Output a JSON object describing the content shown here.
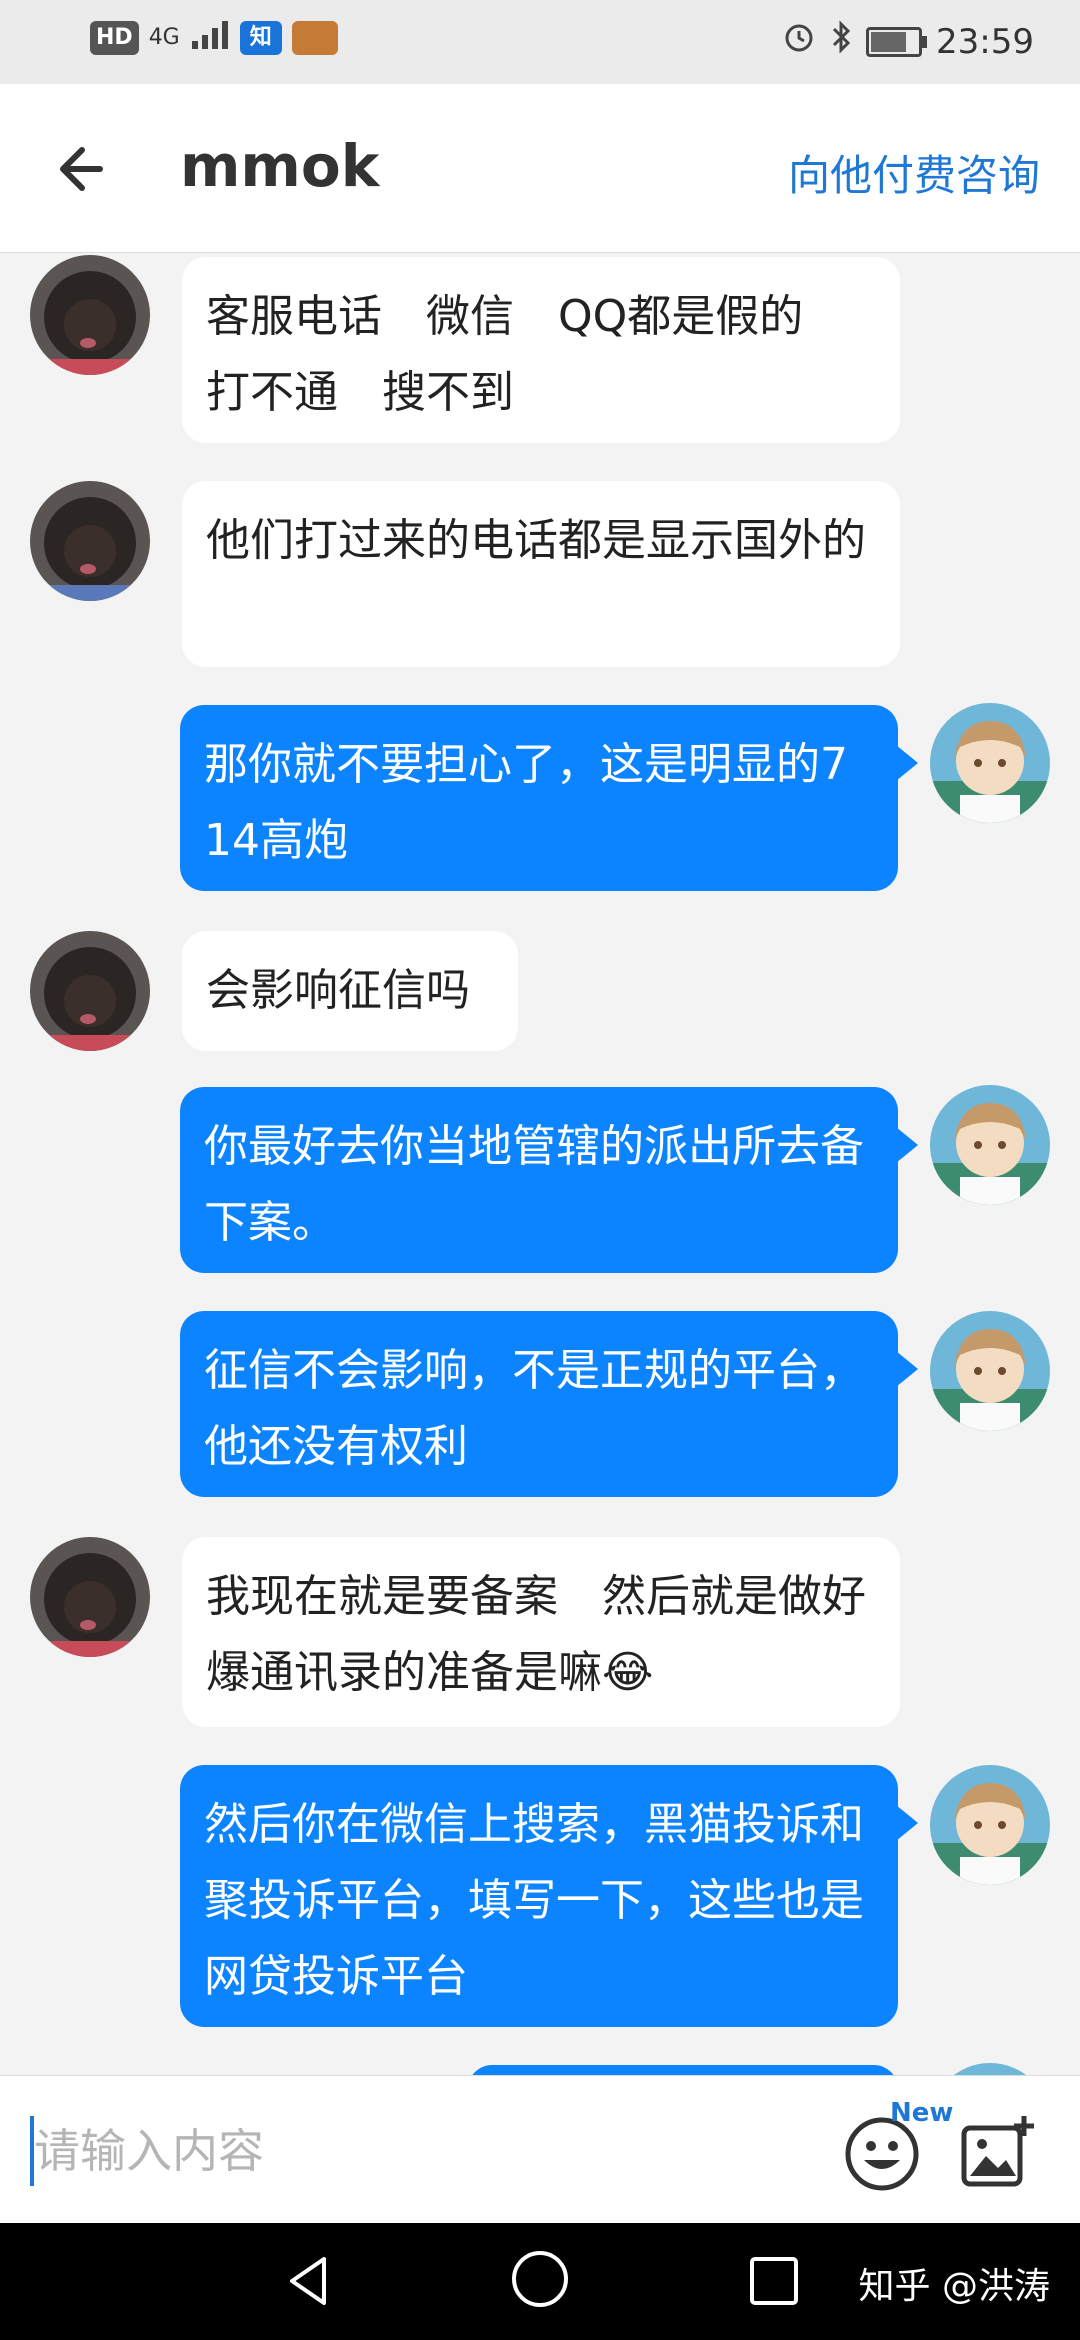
{
  "status_bar": {
    "hd": "HD",
    "network": "4G",
    "zhihu_badge": "知",
    "time": "23:59"
  },
  "header": {
    "back_icon": "arrow-left",
    "title": "mmok",
    "consult_label": "向他付费咨询"
  },
  "messages": [
    {
      "side": "in",
      "text": "客服电话　微信　QQ都是假的　打不通　搜不到"
    },
    {
      "side": "in",
      "text": "他们打过来的电话都是显示国外的"
    },
    {
      "side": "out",
      "text": "那你就不要担心了，这是明显的714高炮"
    },
    {
      "side": "in",
      "text": "会影响征信吗"
    },
    {
      "side": "out",
      "text": "你最好去你当地管辖的派出所去备下案。"
    },
    {
      "side": "out",
      "text": "征信不会影响，不是正规的平台，他还没有权利"
    },
    {
      "side": "in",
      "text": "我现在就是要备案　然后就是做好爆通讯录的准备是嘛😂"
    },
    {
      "side": "out",
      "text": "然后你在微信上搜索，黑猫投诉和聚投诉平台，填写一下，这些也是网贷投诉平台"
    },
    {
      "side": "out",
      "text": ""
    }
  ],
  "input_bar": {
    "placeholder": "请输入内容",
    "new_badge": "New",
    "emoji_icon": "emoji-icon",
    "image_icon": "image-add-icon"
  },
  "nav_bar": {
    "watermark": "知乎 @洪涛"
  }
}
